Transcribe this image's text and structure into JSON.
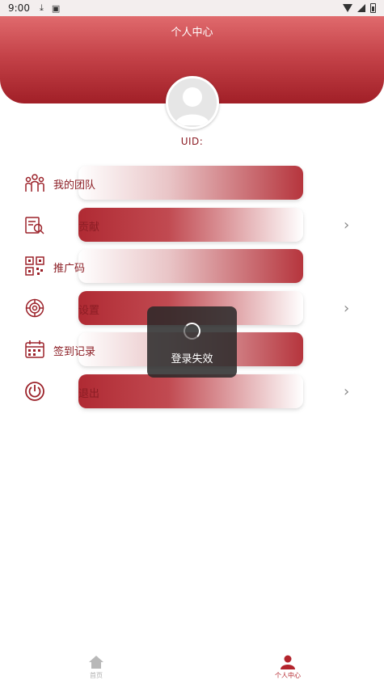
{
  "status_bar": {
    "time": "9:00"
  },
  "header": {
    "title": "个人中心"
  },
  "profile": {
    "uid_label": "UID:"
  },
  "menu": [
    {
      "label": "我的团队",
      "icon": "team-icon",
      "chevron": false
    },
    {
      "label": "贡献",
      "icon": "contribution-search-icon",
      "chevron": true
    },
    {
      "label": "推广码",
      "icon": "qr-code-icon",
      "chevron": false
    },
    {
      "label": "设置",
      "icon": "settings-icon",
      "chevron": true
    },
    {
      "label": "签到记录",
      "icon": "calendar-icon",
      "chevron": false
    },
    {
      "label": "退出",
      "icon": "power-icon",
      "chevron": true
    }
  ],
  "toast": {
    "text": "登录失效"
  },
  "tabs": [
    {
      "label": "首页",
      "icon": "home-icon",
      "active": false
    },
    {
      "label": "个人中心",
      "icon": "user-icon",
      "active": true
    }
  ],
  "colors": {
    "accent": "#a11f27",
    "header_top": "#e06a6d",
    "label": "#8b1d24",
    "inactive_tab": "#b0b0b0"
  }
}
